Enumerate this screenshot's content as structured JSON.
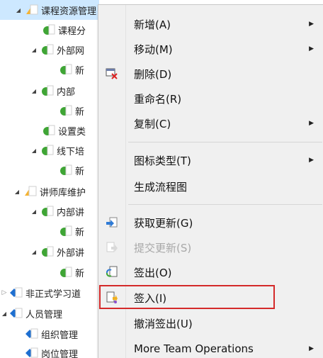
{
  "tree": {
    "items": [
      {
        "label": "课程资源管理",
        "expander": "expanded",
        "icon": "folder",
        "selected": true
      },
      {
        "label": "课程分",
        "expander": "none",
        "icon": "green"
      },
      {
        "label": "外部网",
        "expander": "expanded",
        "icon": "green"
      },
      {
        "label": "新",
        "expander": "none",
        "icon": "green"
      },
      {
        "label": "内部",
        "expander": "expanded",
        "icon": "green"
      },
      {
        "label": "新",
        "expander": "none",
        "icon": "green"
      },
      {
        "label": "设置类",
        "expander": "none",
        "icon": "green"
      },
      {
        "label": "线下培",
        "expander": "expanded",
        "icon": "green"
      },
      {
        "label": "新",
        "expander": "none",
        "icon": "green"
      },
      {
        "label": "讲师库维护",
        "expander": "expanded",
        "icon": "folder"
      },
      {
        "label": "内部讲",
        "expander": "expanded",
        "icon": "green"
      },
      {
        "label": "新",
        "expander": "none",
        "icon": "green"
      },
      {
        "label": "外部讲",
        "expander": "expanded",
        "icon": "green"
      },
      {
        "label": "新",
        "expander": "none",
        "icon": "green"
      },
      {
        "label": "非正式学习道",
        "expander": "collapsed",
        "icon": "blue"
      },
      {
        "label": "人员管理",
        "expander": "expanded",
        "icon": "blue"
      },
      {
        "label": "组织管理",
        "expander": "none",
        "icon": "blue"
      },
      {
        "label": "岗位管理",
        "expander": "none",
        "icon": "blue"
      }
    ]
  },
  "menu": {
    "items": [
      {
        "label": "新增(A)",
        "submenu": true,
        "icon": "",
        "disabled": false
      },
      {
        "label": "移动(M)",
        "submenu": true,
        "icon": "",
        "disabled": false
      },
      {
        "label": "删除(D)",
        "submenu": false,
        "icon": "delete-icon",
        "disabled": false
      },
      {
        "label": "重命名(R)",
        "submenu": false,
        "icon": "",
        "disabled": false
      },
      {
        "label": "复制(C)",
        "submenu": true,
        "icon": "",
        "disabled": false
      },
      {
        "label": "图标类型(T)",
        "submenu": true,
        "icon": "",
        "disabled": false
      },
      {
        "label": "生成流程图",
        "submenu": false,
        "icon": "",
        "disabled": false
      },
      {
        "label": "获取更新(G)",
        "submenu": false,
        "icon": "get-update-icon",
        "disabled": false
      },
      {
        "label": "提交更新(S)",
        "submenu": false,
        "icon": "commit-update-icon",
        "disabled": true
      },
      {
        "label": "签出(O)",
        "submenu": false,
        "icon": "check-out-icon",
        "disabled": false
      },
      {
        "label": "签入(I)",
        "submenu": false,
        "icon": "check-in-icon",
        "disabled": false,
        "highlighted": true
      },
      {
        "label": "撤消签出(U)",
        "submenu": false,
        "icon": "",
        "disabled": false
      },
      {
        "label": "More Team Operations",
        "submenu": true,
        "icon": "",
        "disabled": false
      }
    ]
  },
  "colors": {
    "selection": "#cde8ff",
    "highlight_border": "#d42a2a",
    "menu_bg": "#f0f0f0"
  }
}
